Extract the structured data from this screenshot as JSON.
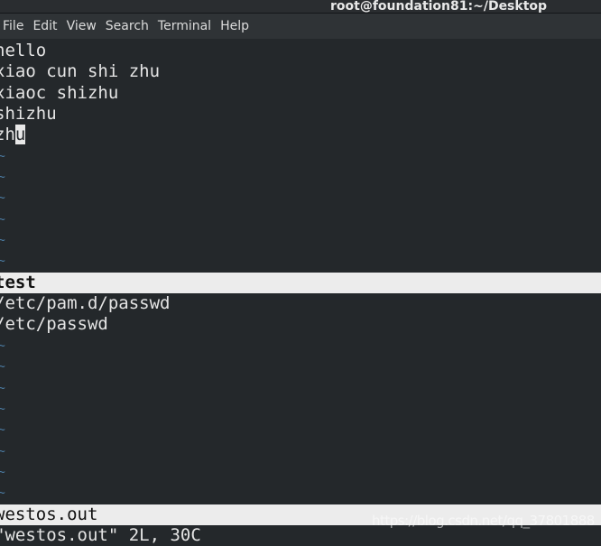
{
  "window": {
    "title": "root@foundation81:~/Desktop"
  },
  "menu": [
    "File",
    "Edit",
    "View",
    "Search",
    "Terminal",
    "Help"
  ],
  "top_pane": {
    "lines": [
      "hello",
      "xiao cun shi zhu",
      "xiaoc shizhu",
      "shizhu"
    ],
    "last_line_before_cursor": "zh",
    "cursor_char": "u",
    "empty_line_marker": "~",
    "empty_lines": 6,
    "status": "test"
  },
  "bottom_pane": {
    "lines": [
      "/etc/pam.d/passwd",
      "/etc/passwd"
    ],
    "empty_line_marker": "~",
    "empty_lines": 8,
    "status": "westos.out"
  },
  "message": "\"westos.out\" 2L, 30C",
  "watermark": "https://blog.csdn.net/qq_37801888"
}
